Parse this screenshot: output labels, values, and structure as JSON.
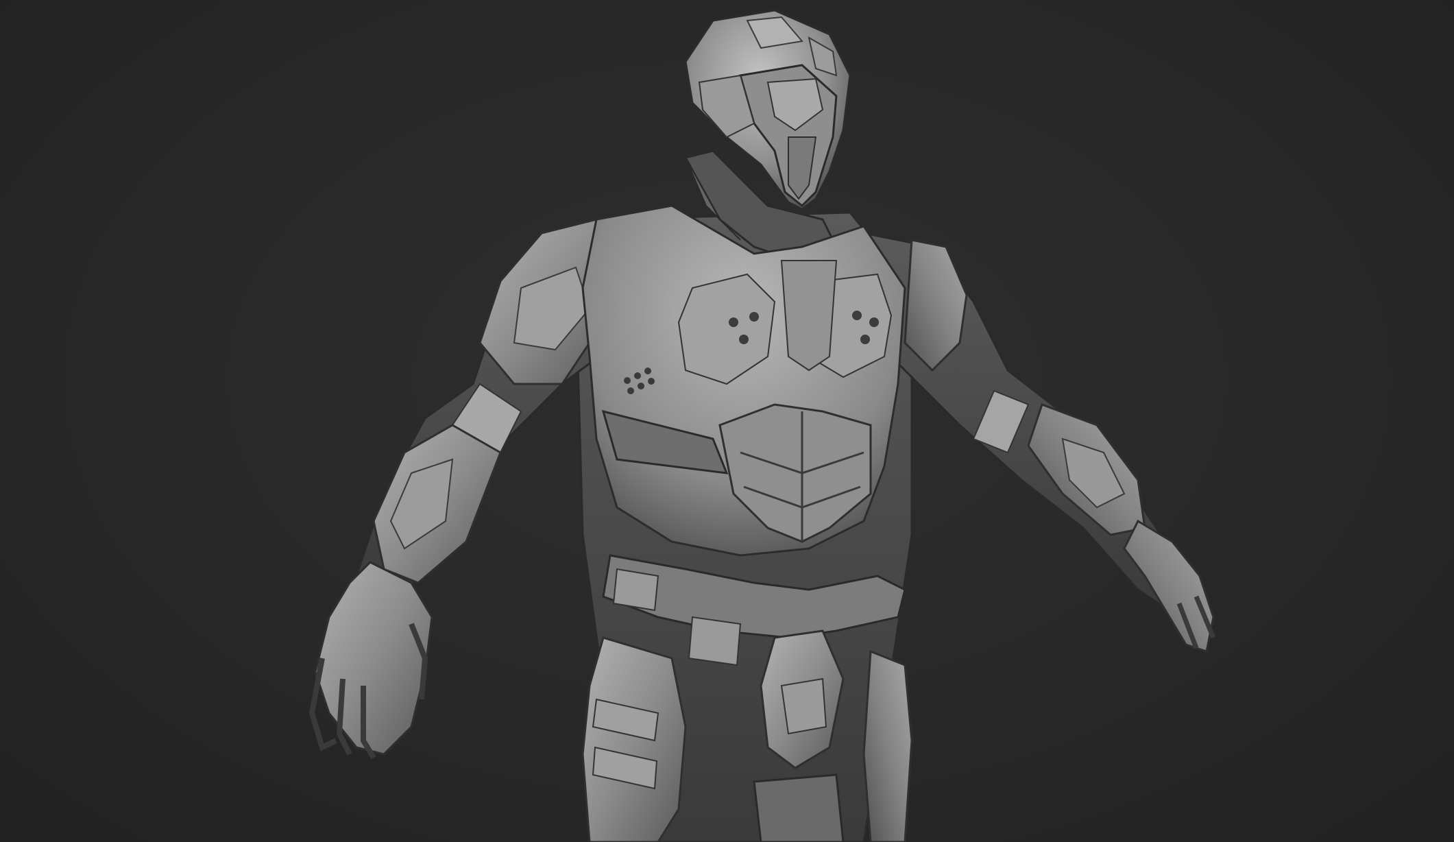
{
  "viewport": {
    "background_color": "#262626",
    "subject": "armored-character-sculpt",
    "material_color": "#8a8a8a"
  }
}
